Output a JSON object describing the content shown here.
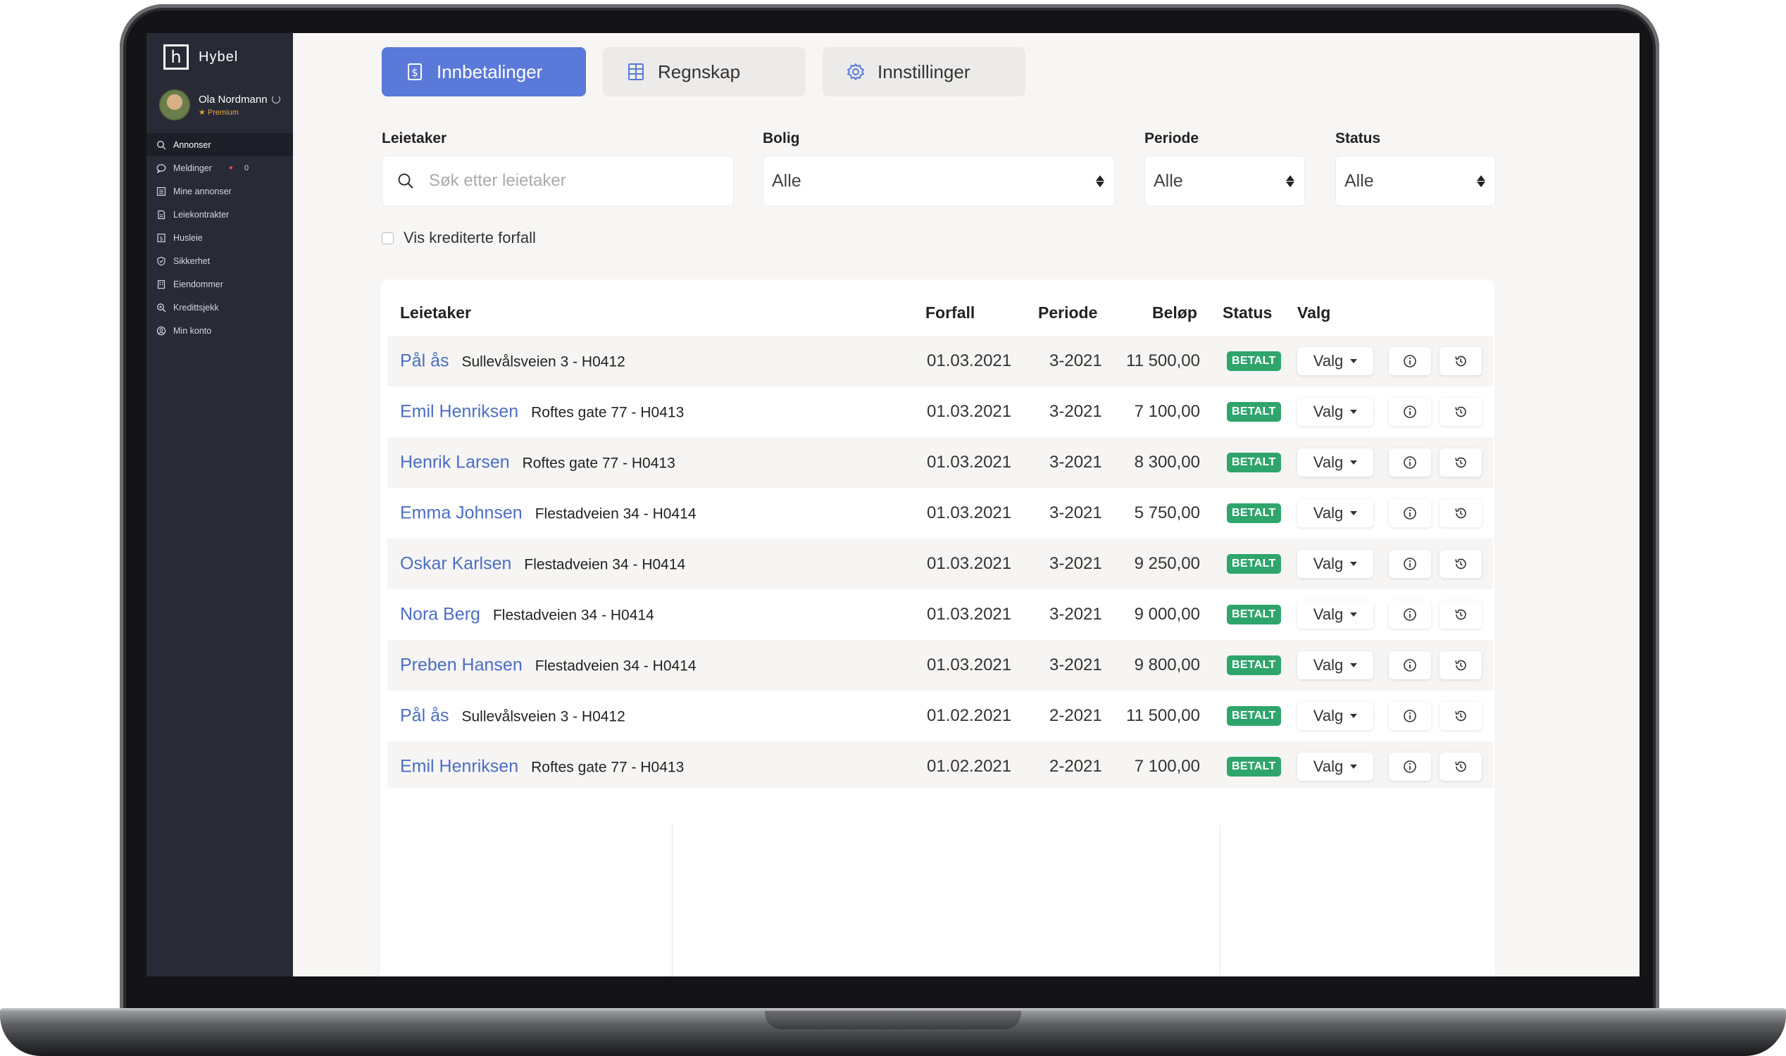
{
  "app": {
    "brand_letter": "h",
    "brand_name": "Hybel",
    "user_name": "Ola Nordmann",
    "user_badge": "★ Premium"
  },
  "sidebar": {
    "items": [
      {
        "label": "Annonser",
        "icon": "search-icon",
        "active": true
      },
      {
        "label": "Meldinger",
        "icon": "chat-icon",
        "badge": "●",
        "count": "0"
      },
      {
        "label": "Mine annonser",
        "icon": "list-icon"
      },
      {
        "label": "Leiekontrakter",
        "icon": "document-icon"
      },
      {
        "label": "Husleie",
        "icon": "currency-icon"
      },
      {
        "label": "Sikkerhet",
        "icon": "shield-icon"
      },
      {
        "label": "Eiendommer",
        "icon": "building-icon"
      },
      {
        "label": "Kredittsjekk",
        "icon": "magnifier-icon"
      },
      {
        "label": "Min konto",
        "icon": "user-icon"
      }
    ]
  },
  "tabs": [
    {
      "label": "Innbetalinger",
      "icon": "dollar-doc-icon",
      "active": true
    },
    {
      "label": "Regnskap",
      "icon": "spreadsheet-icon"
    },
    {
      "label": "Innstillinger",
      "icon": "gear-icon"
    }
  ],
  "filters": {
    "tenant_label": "Leietaker",
    "tenant_placeholder": "Søk etter leietaker",
    "housing_label": "Bolig",
    "housing_value": "Alle",
    "period_label": "Periode",
    "period_value": "Alle",
    "status_label": "Status",
    "status_value": "Alle",
    "credited_label": "Vis krediterte forfall"
  },
  "table": {
    "headers": {
      "tenant": "Leietaker",
      "due": "Forfall",
      "period": "Periode",
      "amount": "Beløp",
      "status": "Status",
      "options": "Valg"
    },
    "valg_label": "Valg",
    "rows": [
      {
        "name": "Pål ås",
        "address": "Sullevålsveien 3 - H0412",
        "due": "01.03.2021",
        "period": "3-2021",
        "amount": "11 500,00",
        "status": "BETALT"
      },
      {
        "name": "Emil Henriksen",
        "address": "Roftes gate 77 - H0413",
        "due": "01.03.2021",
        "period": "3-2021",
        "amount": "7 100,00",
        "status": "BETALT"
      },
      {
        "name": "Henrik Larsen",
        "address": "Roftes gate 77 - H0413",
        "due": "01.03.2021",
        "period": "3-2021",
        "amount": "8 300,00",
        "status": "BETALT"
      },
      {
        "name": "Emma Johnsen",
        "address": "Flestadveien 34 - H0414",
        "due": "01.03.2021",
        "period": "3-2021",
        "amount": "5 750,00",
        "status": "BETALT"
      },
      {
        "name": "Oskar Karlsen",
        "address": "Flestadveien 34 - H0414",
        "due": "01.03.2021",
        "period": "3-2021",
        "amount": "9 250,00",
        "status": "BETALT"
      },
      {
        "name": "Nora Berg",
        "address": "Flestadveien 34 - H0414",
        "due": "01.03.2021",
        "period": "3-2021",
        "amount": "9 000,00",
        "status": "BETALT"
      },
      {
        "name": "Preben Hansen",
        "address": "Flestadveien 34 - H0414",
        "due": "01.03.2021",
        "period": "3-2021",
        "amount": "9 800,00",
        "status": "BETALT"
      },
      {
        "name": "Pål ås",
        "address": "Sullevålsveien 3 - H0412",
        "due": "01.02.2021",
        "period": "2-2021",
        "amount": "11 500,00",
        "status": "BETALT"
      },
      {
        "name": "Emil Henriksen",
        "address": "Roftes gate 77 - H0413",
        "due": "01.02.2021",
        "period": "2-2021",
        "amount": "7 100,00",
        "status": "BETALT"
      }
    ]
  },
  "colors": {
    "accent": "#5a79d8",
    "link": "#4c6dc4",
    "status_paid": "#2fa56c",
    "sidebar_bg": "#282a35"
  }
}
